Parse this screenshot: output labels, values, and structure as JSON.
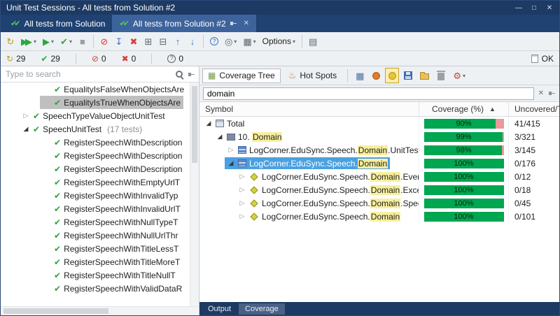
{
  "window": {
    "title": "Unit Test Sessions - All tests from Solution #2",
    "buttons": [
      {
        "name": "minimize-button",
        "glyph": "—"
      },
      {
        "name": "maximize-button",
        "glyph": "□"
      },
      {
        "name": "close-button",
        "glyph": "✕"
      }
    ]
  },
  "glyphs": {
    "dropdown": "▾",
    "close": "✕",
    "sort_asc": "▲",
    "double_check": "✔✔",
    "expanded": "◢",
    "collapsed": "▷",
    "check": "✔"
  },
  "session_tabs": [
    {
      "label": "All tests from Solution",
      "active": false
    },
    {
      "label": "All tests from Solution #2",
      "active": true
    }
  ],
  "toolbar": {
    "items": [
      {
        "name": "rerun-tests-icon",
        "glyph": "↻",
        "color": "#b5a01e"
      },
      {
        "name": "run-all-tests-icon",
        "glyph": "▶▶",
        "color": "#2ba83c",
        "tight": true,
        "dropdown": true
      },
      {
        "name": "run-selected-tests-icon",
        "glyph": "▶",
        "color": "#2ba83c",
        "dropdown": true
      },
      {
        "name": "rerun-failed-tests-icon",
        "glyph": "✔",
        "color": "#2ba83c",
        "dropdown": true
      },
      {
        "name": "stop-icon",
        "glyph": "■",
        "color": "#9aa0a6"
      },
      {
        "sep": true
      },
      {
        "name": "abort-icon",
        "glyph": "⊘",
        "color": "#d2403c"
      },
      {
        "name": "append-tests-icon",
        "glyph": "↧",
        "color": "#3c76c2"
      },
      {
        "name": "remove-tests-icon",
        "glyph": "✖",
        "color": "#d2403c"
      },
      {
        "name": "add-session-icon",
        "glyph": "⊞",
        "color": "#5b6770"
      },
      {
        "name": "close-session-icon",
        "glyph": "⊟",
        "color": "#5b6770"
      },
      {
        "name": "previous-test-icon",
        "glyph": "↑",
        "color": "#3c76c2"
      },
      {
        "name": "next-test-icon",
        "glyph": "↓",
        "color": "#3c76c2"
      },
      {
        "sep": true
      },
      {
        "name": "inconclusive-filter-icon",
        "glyph": "?",
        "color": "#3c76c2",
        "circle": true
      },
      {
        "name": "group-by-icon",
        "glyph": "◎",
        "color": "#5b6770",
        "dropdown": true
      },
      {
        "name": "columns-icon",
        "glyph": "▦",
        "color": "#5b6770",
        "dropdown": true
      },
      {
        "name": "options-button",
        "label": "Options",
        "dropdown": true
      },
      {
        "sep": true
      },
      {
        "name": "export-icon",
        "glyph": "▤",
        "color": "#5b6770"
      }
    ]
  },
  "status": {
    "counts": [
      {
        "name": "status-total",
        "glyph": "↻",
        "color": "#b5a01e",
        "value": "29"
      },
      {
        "name": "status-passed",
        "glyph": "✔",
        "color": "#2ba83c",
        "value": "29"
      },
      {
        "sep": true
      },
      {
        "name": "status-failed",
        "glyph": "⊘",
        "color": "#d2403c",
        "value": "0"
      },
      {
        "name": "status-aborted",
        "glyph": "✖",
        "color": "#d2403c",
        "value": "0"
      },
      {
        "sep": true
      },
      {
        "name": "status-inconclusive",
        "glyph": "?",
        "color": "#5b6770",
        "value": "0",
        "circle": true
      }
    ],
    "ok_label": "OK"
  },
  "left": {
    "search_placeholder": "Type to search",
    "tree": [
      {
        "level": 2,
        "label": "EqualityIsFalseWhenObjectsAre"
      },
      {
        "level": 2,
        "label": "EqualityIsTrueWhenObjectsAre",
        "selected": true
      },
      {
        "level": 1,
        "expander": "collapsed",
        "label": "SpeechTypeValueObjectUnitTest"
      },
      {
        "level": 1,
        "expander": "expanded",
        "label": "SpeechUnitTest",
        "note": "(17 tests)"
      },
      {
        "level": 2,
        "label": "RegisterSpeechWithDescription"
      },
      {
        "level": 2,
        "label": "RegisterSpeechWithDescription"
      },
      {
        "level": 2,
        "label": "RegisterSpeechWithDescription"
      },
      {
        "level": 2,
        "label": "RegisterSpeechWithEmptyUrlT"
      },
      {
        "level": 2,
        "label": "RegisterSpeechWithInvalidTyp"
      },
      {
        "level": 2,
        "label": "RegisterSpeechWithInvalidUrlT"
      },
      {
        "level": 2,
        "label": "RegisterSpeechWithNullTypeT"
      },
      {
        "level": 2,
        "label": "RegisterSpeechWithNullUrlThr"
      },
      {
        "level": 2,
        "label": "RegisterSpeechWithTitleLessT"
      },
      {
        "level": 2,
        "label": "RegisterSpeechWithTitleMoreT"
      },
      {
        "level": 2,
        "label": "RegisterSpeechWithTitleNullT"
      },
      {
        "level": 2,
        "label": "RegisterSpeechWithValidDataR"
      }
    ]
  },
  "right": {
    "tabs": [
      {
        "label": "Coverage Tree",
        "icon": "coverage-tree-icon",
        "active": true
      },
      {
        "label": "Hot Spots",
        "icon": "flame-icon",
        "active": false
      }
    ],
    "toolbar": [
      {
        "name": "statistics-icon",
        "type": "glyph",
        "glyph": "▦",
        "color": "#4a6fa5"
      },
      {
        "name": "highlight-risks-icon",
        "type": "flash",
        "color": "#e07b2a"
      },
      {
        "name": "highlight-coverage-icon",
        "type": "flash",
        "color": "#e8c832",
        "pressed": true
      },
      {
        "name": "save-coverage-icon",
        "type": "floppy"
      },
      {
        "name": "open-coverage-icon",
        "type": "folder"
      },
      {
        "name": "delete-coverage-icon",
        "type": "trash"
      },
      {
        "name": "configure-highlighting-icon",
        "type": "glyph",
        "glyph": "⚙",
        "color": "#c2463c",
        "dropdown": true
      }
    ],
    "filter": {
      "value": "domain"
    },
    "columns": [
      {
        "label": "Symbol"
      },
      {
        "label": "Coverage (%)",
        "sort": "asc"
      },
      {
        "label": "Uncovered/Tota"
      }
    ],
    "rows": [
      {
        "level": 0,
        "expander": "expanded",
        "icon": "total",
        "parts": [
          {
            "text": "Total"
          }
        ],
        "pct": 90,
        "uncovered": "41/415"
      },
      {
        "level": 1,
        "expander": "expanded",
        "icon": "project",
        "parts": [
          {
            "text": "10. "
          },
          {
            "text": "Domain",
            "hl": true
          }
        ],
        "pct": 99,
        "uncovered": "3/321"
      },
      {
        "level": 2,
        "expander": "collapsed",
        "icon": "assembly",
        "parts": [
          {
            "text": "LogCorner.EduSync.Speech."
          },
          {
            "text": "Domain",
            "hl": true
          },
          {
            "text": ".UnitTest"
          }
        ],
        "pct": 98,
        "uncovered": "3/145"
      },
      {
        "level": 2,
        "expander": "expanded",
        "icon": "assembly",
        "selected": true,
        "parts": [
          {
            "text": "LogCorner.EduSync.Speech."
          },
          {
            "text": "Domain",
            "hl": true
          }
        ],
        "pct": 100,
        "uncovered": "0/176"
      },
      {
        "level": 3,
        "expander": "collapsed",
        "icon": "namespace",
        "parts": [
          {
            "text": "LogCorner.EduSync.Speech."
          },
          {
            "text": "Domain",
            "hl": true
          },
          {
            "text": ".Event"
          }
        ],
        "pct": 100,
        "uncovered": "0/12"
      },
      {
        "level": 3,
        "expander": "collapsed",
        "icon": "namespace",
        "parts": [
          {
            "text": "LogCorner.EduSync.Speech."
          },
          {
            "text": "Domain",
            "hl": true
          },
          {
            "text": ".Excep"
          }
        ],
        "pct": 100,
        "uncovered": "0/18"
      },
      {
        "level": 3,
        "expander": "collapsed",
        "icon": "namespace",
        "parts": [
          {
            "text": "LogCorner.EduSync.Speech."
          },
          {
            "text": "Domain",
            "hl": true
          },
          {
            "text": ".Speec"
          }
        ],
        "pct": 100,
        "uncovered": "0/45"
      },
      {
        "level": 3,
        "expander": "collapsed",
        "icon": "namespace",
        "parts": [
          {
            "text": "LogCorner.EduSync.Speech."
          },
          {
            "text": "Domain",
            "hl": true
          }
        ],
        "pct": 100,
        "uncovered": "0/101"
      }
    ]
  },
  "bottom_tabs": [
    {
      "label": "Output",
      "active": false
    },
    {
      "label": "Coverage",
      "active": true
    }
  ]
}
